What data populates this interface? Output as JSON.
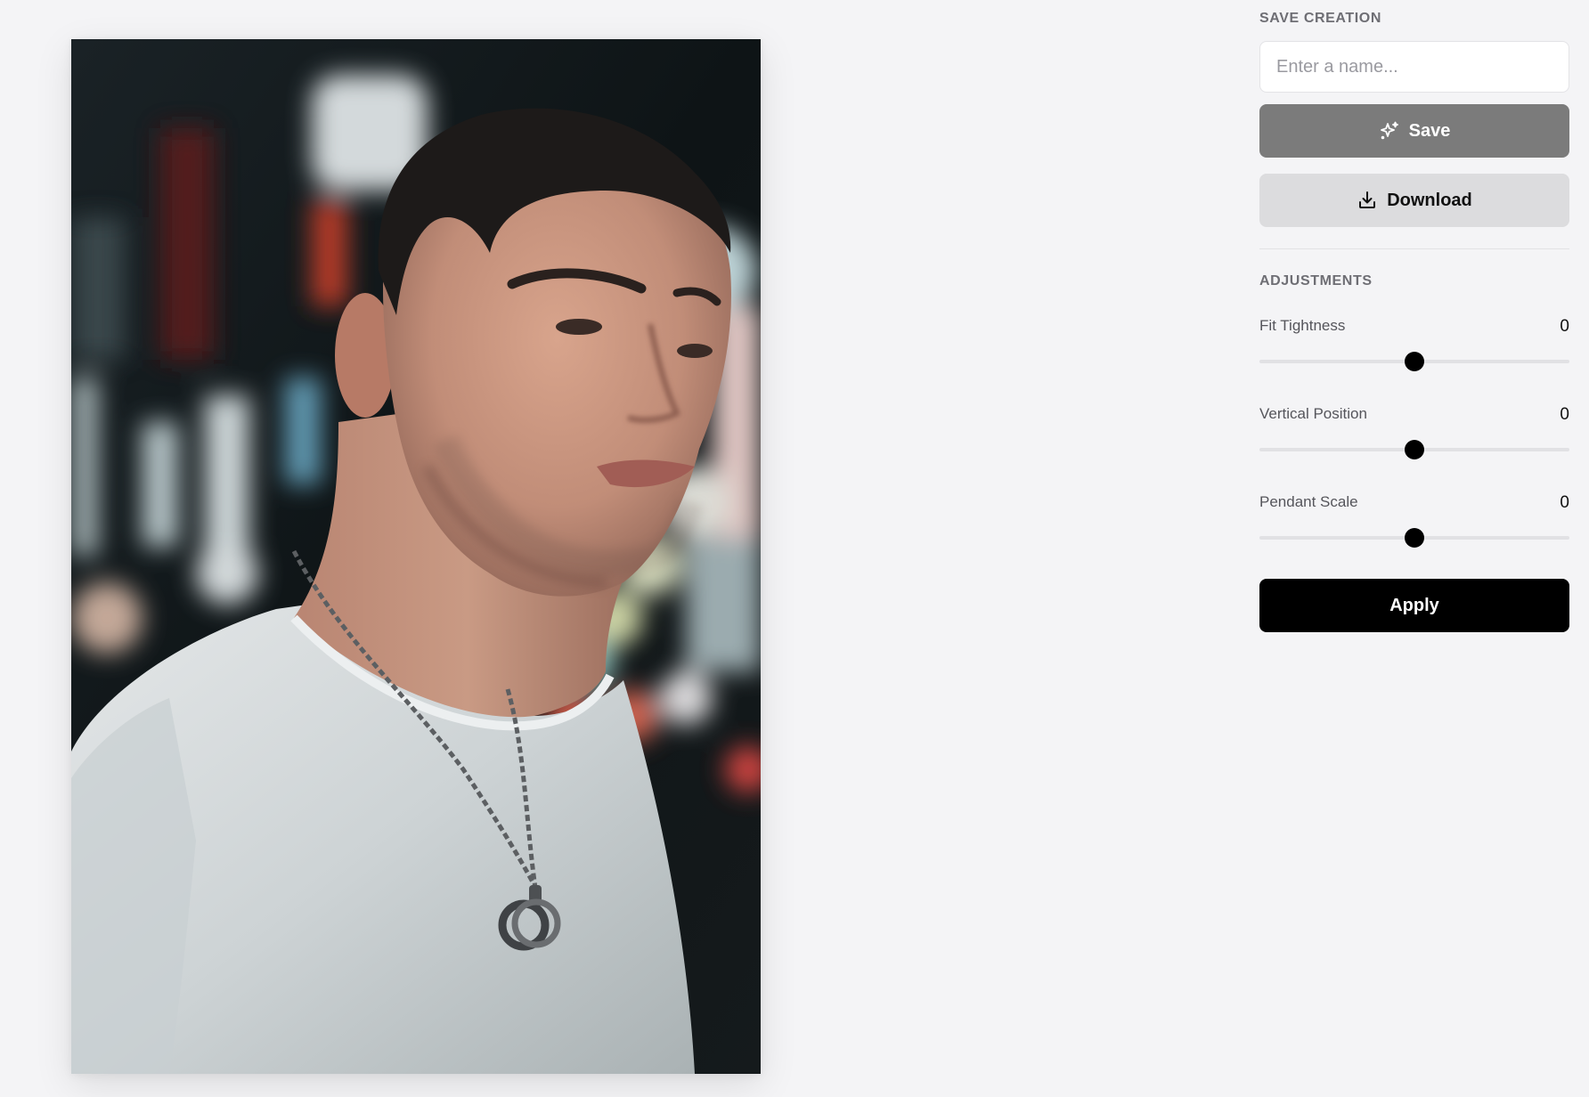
{
  "save_section": {
    "title": "SAVE CREATION",
    "name_placeholder": "Enter a name...",
    "name_value": "",
    "save_label": "Save",
    "save_icon": "sparkle-icon",
    "download_label": "Download",
    "download_icon": "download-icon"
  },
  "adjustments": {
    "title": "ADJUSTMENTS",
    "sliders": [
      {
        "label": "Fit Tightness",
        "value": "0",
        "level": 0.5
      },
      {
        "label": "Vertical Position",
        "value": "0",
        "level": 0.5
      },
      {
        "label": "Pendant Scale",
        "value": "0",
        "level": 0.5
      }
    ],
    "apply_label": "Apply"
  },
  "colors": {
    "save_button": "#7b7b7b",
    "download_button": "#dcdcde",
    "apply_button": "#000000",
    "slider_thumb": "#000000",
    "background": "#f4f4f6"
  }
}
